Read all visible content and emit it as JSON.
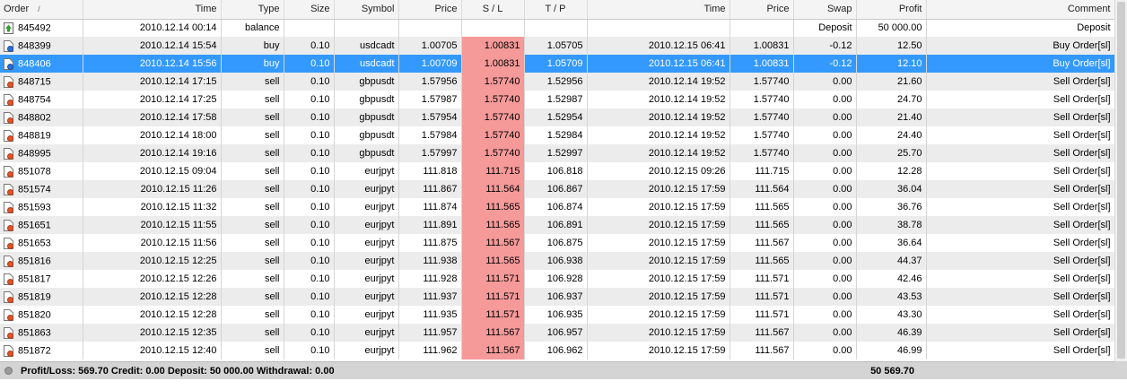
{
  "columns": {
    "order": "Order",
    "sort_indicator": "/",
    "time": "Time",
    "type": "Type",
    "size": "Size",
    "symbol": "Symbol",
    "price": "Price",
    "sl": "S / L",
    "tp": "T / P",
    "close_time": "Time",
    "close_price": "Price",
    "swap": "Swap",
    "profit": "Profit",
    "comment": "Comment"
  },
  "colors": {
    "selected": "#3399ff",
    "sl_highlight": "#f59999",
    "stripe": "#ececec"
  },
  "rows": [
    {
      "icon": "deposit-icon",
      "order": "845492",
      "time": "2010.12.14 00:14",
      "type": "balance",
      "size": "",
      "symbol": "",
      "price": "",
      "sl": "",
      "tp": "",
      "close_time": "",
      "close_price": "",
      "swap": "Deposit",
      "profit": "50 000.00",
      "comment": "Deposit",
      "selected": false
    },
    {
      "icon": "buy-order-icon",
      "order": "848399",
      "time": "2010.12.14 15:54",
      "type": "buy",
      "size": "0.10",
      "symbol": "usdcadt",
      "price": "1.00705",
      "sl": "1.00831",
      "tp": "1.05705",
      "close_time": "2010.12.15 06:41",
      "close_price": "1.00831",
      "swap": "-0.12",
      "profit": "12.50",
      "comment": "Buy Order[sl]",
      "selected": false
    },
    {
      "icon": "buy-order-icon",
      "order": "848406",
      "time": "2010.12.14 15:56",
      "type": "buy",
      "size": "0.10",
      "symbol": "usdcadt",
      "price": "1.00709",
      "sl": "1.00831",
      "tp": "1.05709",
      "close_time": "2010.12.15 06:41",
      "close_price": "1.00831",
      "swap": "-0.12",
      "profit": "12.10",
      "comment": "Buy Order[sl]",
      "selected": true
    },
    {
      "icon": "sell-order-icon",
      "order": "848715",
      "time": "2010.12.14 17:15",
      "type": "sell",
      "size": "0.10",
      "symbol": "gbpusdt",
      "price": "1.57956",
      "sl": "1.57740",
      "tp": "1.52956",
      "close_time": "2010.12.14 19:52",
      "close_price": "1.57740",
      "swap": "0.00",
      "profit": "21.60",
      "comment": "Sell Order[sl]",
      "selected": false
    },
    {
      "icon": "sell-order-icon",
      "order": "848754",
      "time": "2010.12.14 17:25",
      "type": "sell",
      "size": "0.10",
      "symbol": "gbpusdt",
      "price": "1.57987",
      "sl": "1.57740",
      "tp": "1.52987",
      "close_time": "2010.12.14 19:52",
      "close_price": "1.57740",
      "swap": "0.00",
      "profit": "24.70",
      "comment": "Sell Order[sl]",
      "selected": false
    },
    {
      "icon": "sell-order-icon",
      "order": "848802",
      "time": "2010.12.14 17:58",
      "type": "sell",
      "size": "0.10",
      "symbol": "gbpusdt",
      "price": "1.57954",
      "sl": "1.57740",
      "tp": "1.52954",
      "close_time": "2010.12.14 19:52",
      "close_price": "1.57740",
      "swap": "0.00",
      "profit": "21.40",
      "comment": "Sell Order[sl]",
      "selected": false
    },
    {
      "icon": "sell-order-icon",
      "order": "848819",
      "time": "2010.12.14 18:00",
      "type": "sell",
      "size": "0.10",
      "symbol": "gbpusdt",
      "price": "1.57984",
      "sl": "1.57740",
      "tp": "1.52984",
      "close_time": "2010.12.14 19:52",
      "close_price": "1.57740",
      "swap": "0.00",
      "profit": "24.40",
      "comment": "Sell Order[sl]",
      "selected": false
    },
    {
      "icon": "sell-order-icon",
      "order": "848995",
      "time": "2010.12.14 19:16",
      "type": "sell",
      "size": "0.10",
      "symbol": "gbpusdt",
      "price": "1.57997",
      "sl": "1.57740",
      "tp": "1.52997",
      "close_time": "2010.12.14 19:52",
      "close_price": "1.57740",
      "swap": "0.00",
      "profit": "25.70",
      "comment": "Sell Order[sl]",
      "selected": false
    },
    {
      "icon": "sell-order-icon",
      "order": "851078",
      "time": "2010.12.15 09:04",
      "type": "sell",
      "size": "0.10",
      "symbol": "eurjpyt",
      "price": "111.818",
      "sl": "111.715",
      "tp": "106.818",
      "close_time": "2010.12.15 09:26",
      "close_price": "111.715",
      "swap": "0.00",
      "profit": "12.28",
      "comment": "Sell Order[sl]",
      "selected": false
    },
    {
      "icon": "sell-order-icon",
      "order": "851574",
      "time": "2010.12.15 11:26",
      "type": "sell",
      "size": "0.10",
      "symbol": "eurjpyt",
      "price": "111.867",
      "sl": "111.564",
      "tp": "106.867",
      "close_time": "2010.12.15 17:59",
      "close_price": "111.564",
      "swap": "0.00",
      "profit": "36.04",
      "comment": "Sell Order[sl]",
      "selected": false
    },
    {
      "icon": "sell-order-icon",
      "order": "851593",
      "time": "2010.12.15 11:32",
      "type": "sell",
      "size": "0.10",
      "symbol": "eurjpyt",
      "price": "111.874",
      "sl": "111.565",
      "tp": "106.874",
      "close_time": "2010.12.15 17:59",
      "close_price": "111.565",
      "swap": "0.00",
      "profit": "36.76",
      "comment": "Sell Order[sl]",
      "selected": false
    },
    {
      "icon": "sell-order-icon",
      "order": "851651",
      "time": "2010.12.15 11:55",
      "type": "sell",
      "size": "0.10",
      "symbol": "eurjpyt",
      "price": "111.891",
      "sl": "111.565",
      "tp": "106.891",
      "close_time": "2010.12.15 17:59",
      "close_price": "111.565",
      "swap": "0.00",
      "profit": "38.78",
      "comment": "Sell Order[sl]",
      "selected": false
    },
    {
      "icon": "sell-order-icon",
      "order": "851653",
      "time": "2010.12.15 11:56",
      "type": "sell",
      "size": "0.10",
      "symbol": "eurjpyt",
      "price": "111.875",
      "sl": "111.567",
      "tp": "106.875",
      "close_time": "2010.12.15 17:59",
      "close_price": "111.567",
      "swap": "0.00",
      "profit": "36.64",
      "comment": "Sell Order[sl]",
      "selected": false
    },
    {
      "icon": "sell-order-icon",
      "order": "851816",
      "time": "2010.12.15 12:25",
      "type": "sell",
      "size": "0.10",
      "symbol": "eurjpyt",
      "price": "111.938",
      "sl": "111.565",
      "tp": "106.938",
      "close_time": "2010.12.15 17:59",
      "close_price": "111.565",
      "swap": "0.00",
      "profit": "44.37",
      "comment": "Sell Order[sl]",
      "selected": false
    },
    {
      "icon": "sell-order-icon",
      "order": "851817",
      "time": "2010.12.15 12:26",
      "type": "sell",
      "size": "0.10",
      "symbol": "eurjpyt",
      "price": "111.928",
      "sl": "111.571",
      "tp": "106.928",
      "close_time": "2010.12.15 17:59",
      "close_price": "111.571",
      "swap": "0.00",
      "profit": "42.46",
      "comment": "Sell Order[sl]",
      "selected": false
    },
    {
      "icon": "sell-order-icon",
      "order": "851819",
      "time": "2010.12.15 12:28",
      "type": "sell",
      "size": "0.10",
      "symbol": "eurjpyt",
      "price": "111.937",
      "sl": "111.571",
      "tp": "106.937",
      "close_time": "2010.12.15 17:59",
      "close_price": "111.571",
      "swap": "0.00",
      "profit": "43.53",
      "comment": "Sell Order[sl]",
      "selected": false
    },
    {
      "icon": "sell-order-icon",
      "order": "851820",
      "time": "2010.12.15 12:28",
      "type": "sell",
      "size": "0.10",
      "symbol": "eurjpyt",
      "price": "111.935",
      "sl": "111.571",
      "tp": "106.935",
      "close_time": "2010.12.15 17:59",
      "close_price": "111.571",
      "swap": "0.00",
      "profit": "43.30",
      "comment": "Sell Order[sl]",
      "selected": false
    },
    {
      "icon": "sell-order-icon",
      "order": "851863",
      "time": "2010.12.15 12:35",
      "type": "sell",
      "size": "0.10",
      "symbol": "eurjpyt",
      "price": "111.957",
      "sl": "111.567",
      "tp": "106.957",
      "close_time": "2010.12.15 17:59",
      "close_price": "111.567",
      "swap": "0.00",
      "profit": "46.39",
      "comment": "Sell Order[sl]",
      "selected": false
    },
    {
      "icon": "sell-order-icon",
      "order": "851872",
      "time": "2010.12.15 12:40",
      "type": "sell",
      "size": "0.10",
      "symbol": "eurjpyt",
      "price": "111.962",
      "sl": "111.567",
      "tp": "106.962",
      "close_time": "2010.12.15 17:59",
      "close_price": "111.567",
      "swap": "0.00",
      "profit": "46.99",
      "comment": "Sell Order[sl]",
      "selected": false
    }
  ],
  "status": {
    "summary": "Profit/Loss: 569.70  Credit: 0.00  Deposit: 50 000.00  Withdrawal: 0.00",
    "total": "50 569.70"
  }
}
